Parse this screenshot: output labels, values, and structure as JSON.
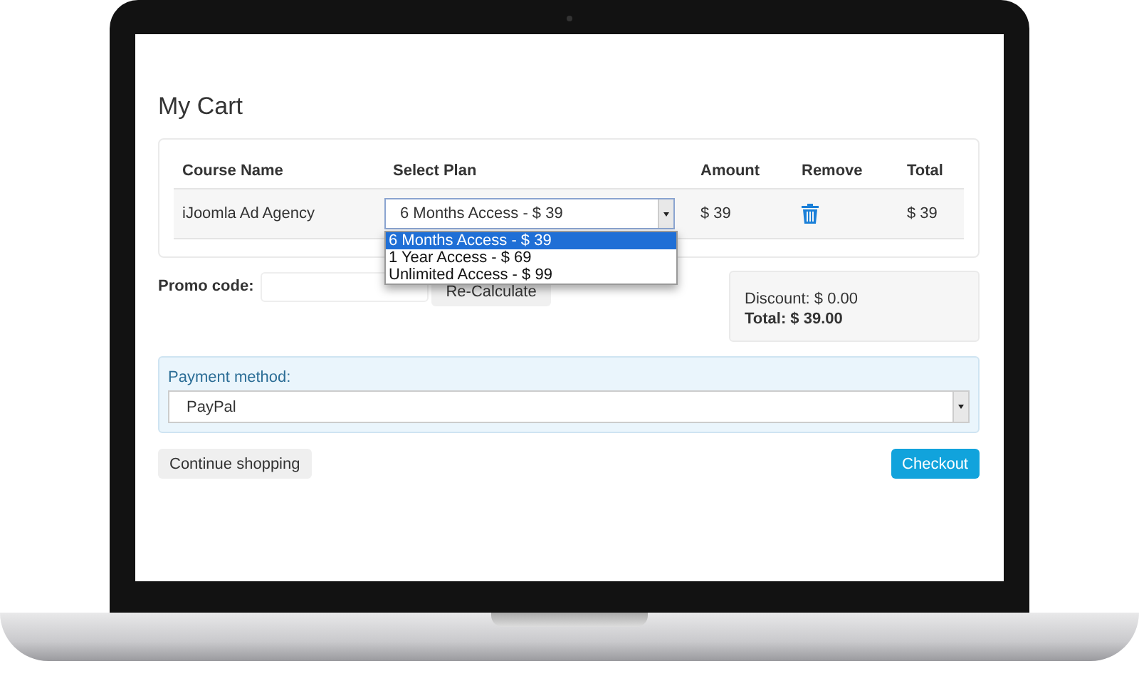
{
  "page_title": "My Cart",
  "table": {
    "columns": [
      "Course Name",
      "Select Plan",
      "Amount",
      "Remove",
      "Total"
    ],
    "rows": [
      {
        "course": "iJoomla Ad Agency",
        "plan": "6 Months Access - $ 39",
        "amount": "$ 39",
        "total": "$ 39"
      }
    ]
  },
  "plan_dropdown": {
    "expanded": true,
    "options": [
      {
        "label": "6 Months Access - $ 39",
        "selected": true
      },
      {
        "label": "1 Year Access - $ 69",
        "selected": false
      },
      {
        "label": "Unlimited Access - $ 99",
        "selected": false
      }
    ]
  },
  "promo": {
    "label": "Promo code:",
    "button": "Re-Calculate"
  },
  "summary": {
    "discount": "Discount: $ 0.00",
    "total": "Total: $ 39.00"
  },
  "payment": {
    "label": "Payment method:",
    "value": "PayPal"
  },
  "buttons": {
    "continue": "Continue shopping",
    "checkout": "Checkout"
  }
}
